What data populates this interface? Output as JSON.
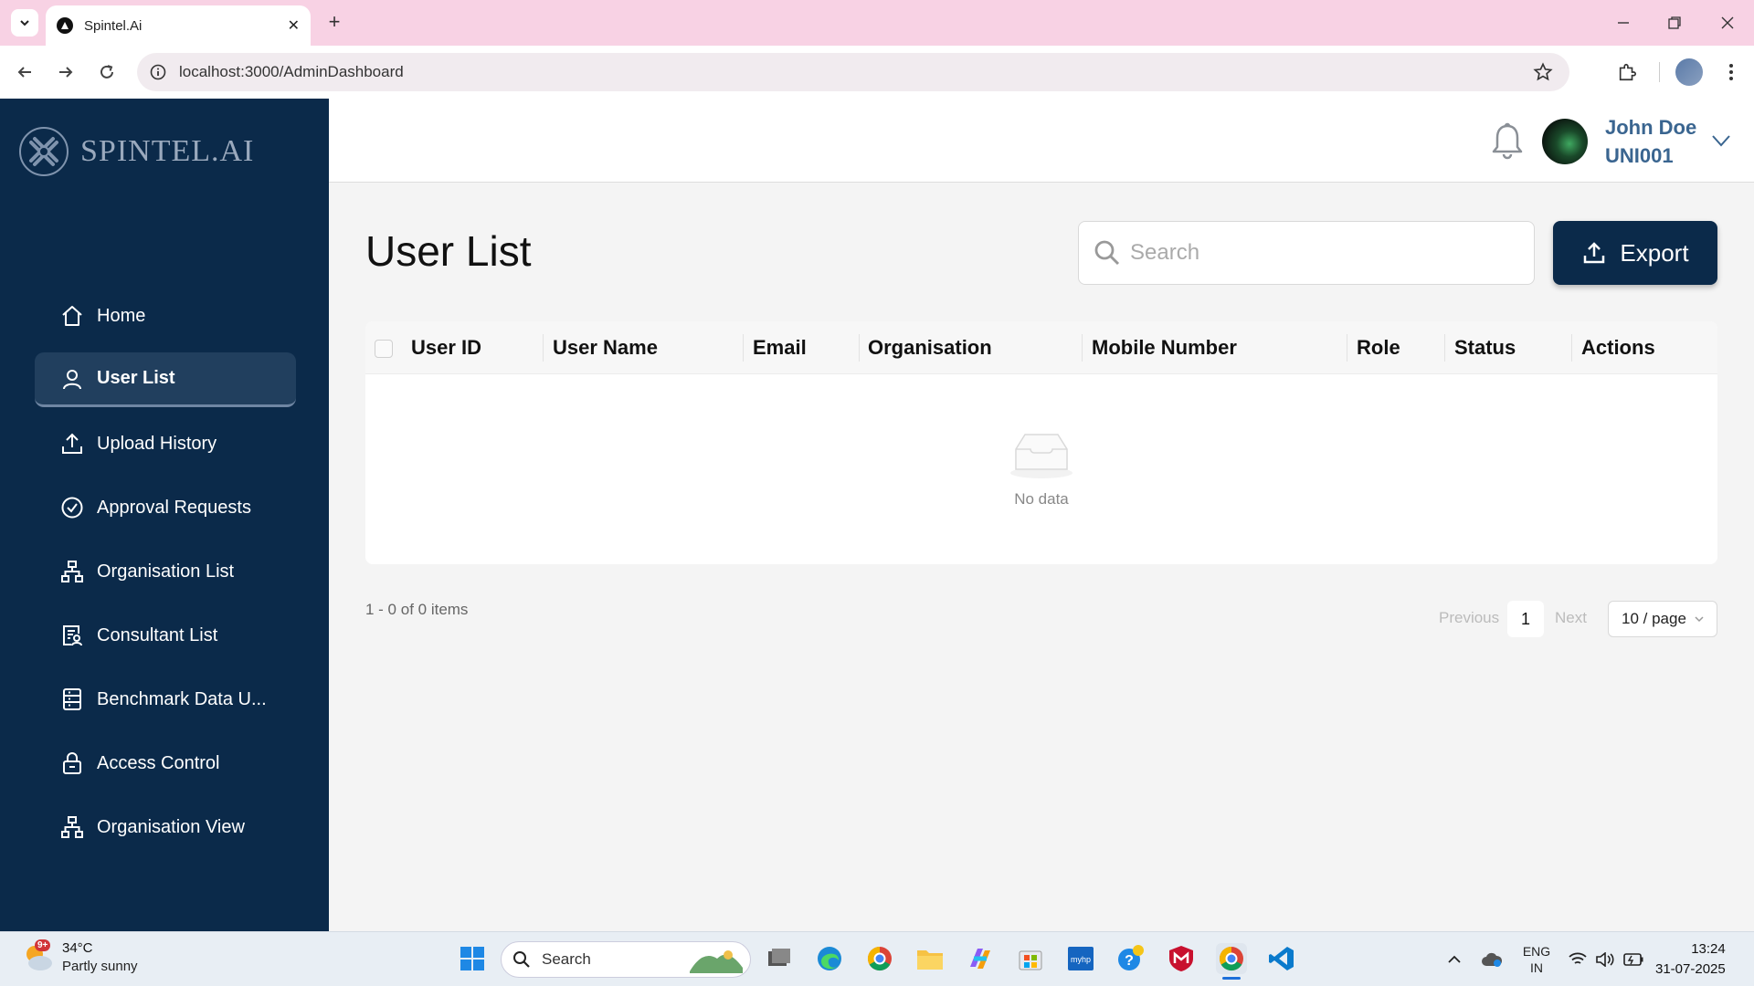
{
  "browser": {
    "tab_title": "Spintel.Ai",
    "url": "localhost:3000/AdminDashboard"
  },
  "sidebar": {
    "logo_text": "SPINTEL.AI",
    "items": [
      {
        "label": "Home",
        "icon": "home-icon"
      },
      {
        "label": "User List",
        "icon": "user-icon",
        "active": true
      },
      {
        "label": "Upload History",
        "icon": "upload-icon"
      },
      {
        "label": "Approval Requests",
        "icon": "check-circle-icon"
      },
      {
        "label": "Organisation List",
        "icon": "hierarchy-icon"
      },
      {
        "label": "Consultant List",
        "icon": "consultant-list-icon"
      },
      {
        "label": "Benchmark Data U...",
        "icon": "benchmark-icon"
      },
      {
        "label": "Access Control",
        "icon": "lock-icon"
      },
      {
        "label": "Organisation View",
        "icon": "hierarchy-icon"
      }
    ]
  },
  "header": {
    "user_name": "John Doe",
    "user_code": "UNI001"
  },
  "main": {
    "title": "User List",
    "search_placeholder": "Search",
    "export_label": "Export",
    "columns": [
      "User ID",
      "User Name",
      "Email",
      "Organisation",
      "Mobile Number",
      "Role",
      "Status",
      "Actions"
    ],
    "empty_text": "No data",
    "pagination": {
      "range_text": "1 - 0 of 0 items",
      "previous": "Previous",
      "current_page": "1",
      "next": "Next",
      "page_size": "10 / page"
    }
  },
  "taskbar": {
    "weather_badge": "9+",
    "temperature": "34°C",
    "weather_desc": "Partly sunny",
    "search_label": "Search",
    "lang_1": "ENG",
    "lang_2": "IN",
    "time": "13:24",
    "date": "31-07-2025"
  },
  "colors": {
    "sidebar_bg": "#0b2a4a",
    "accent": "#0b2a4a",
    "user_name": "#3a6590",
    "tabbar_bg": "#f8d2e4"
  }
}
